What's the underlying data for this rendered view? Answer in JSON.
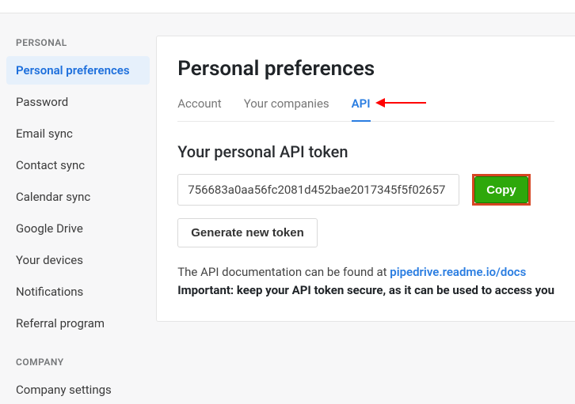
{
  "sidebar": {
    "sections": [
      {
        "label": "PERSONAL",
        "items": [
          {
            "label": "Personal preferences",
            "active": true
          },
          {
            "label": "Password"
          },
          {
            "label": "Email sync"
          },
          {
            "label": "Contact sync"
          },
          {
            "label": "Calendar sync"
          },
          {
            "label": "Google Drive"
          },
          {
            "label": "Your devices"
          },
          {
            "label": "Notifications"
          },
          {
            "label": "Referral program"
          }
        ]
      },
      {
        "label": "COMPANY",
        "items": [
          {
            "label": "Company settings"
          }
        ]
      }
    ]
  },
  "page": {
    "title": "Personal preferences",
    "tabs": [
      {
        "label": "Account"
      },
      {
        "label": "Your companies"
      },
      {
        "label": "API",
        "active": true
      }
    ]
  },
  "api": {
    "heading": "Your personal API token",
    "token": "756683a0aa56fc2081d452bae2017345f5f02657",
    "copy_label": "Copy",
    "generate_label": "Generate new token",
    "docs_prefix": "The API documentation can be found at ",
    "docs_link_text": "pipedrive.readme.io/docs",
    "important_text": "Important: keep your API token secure, as it can be used to access you"
  }
}
